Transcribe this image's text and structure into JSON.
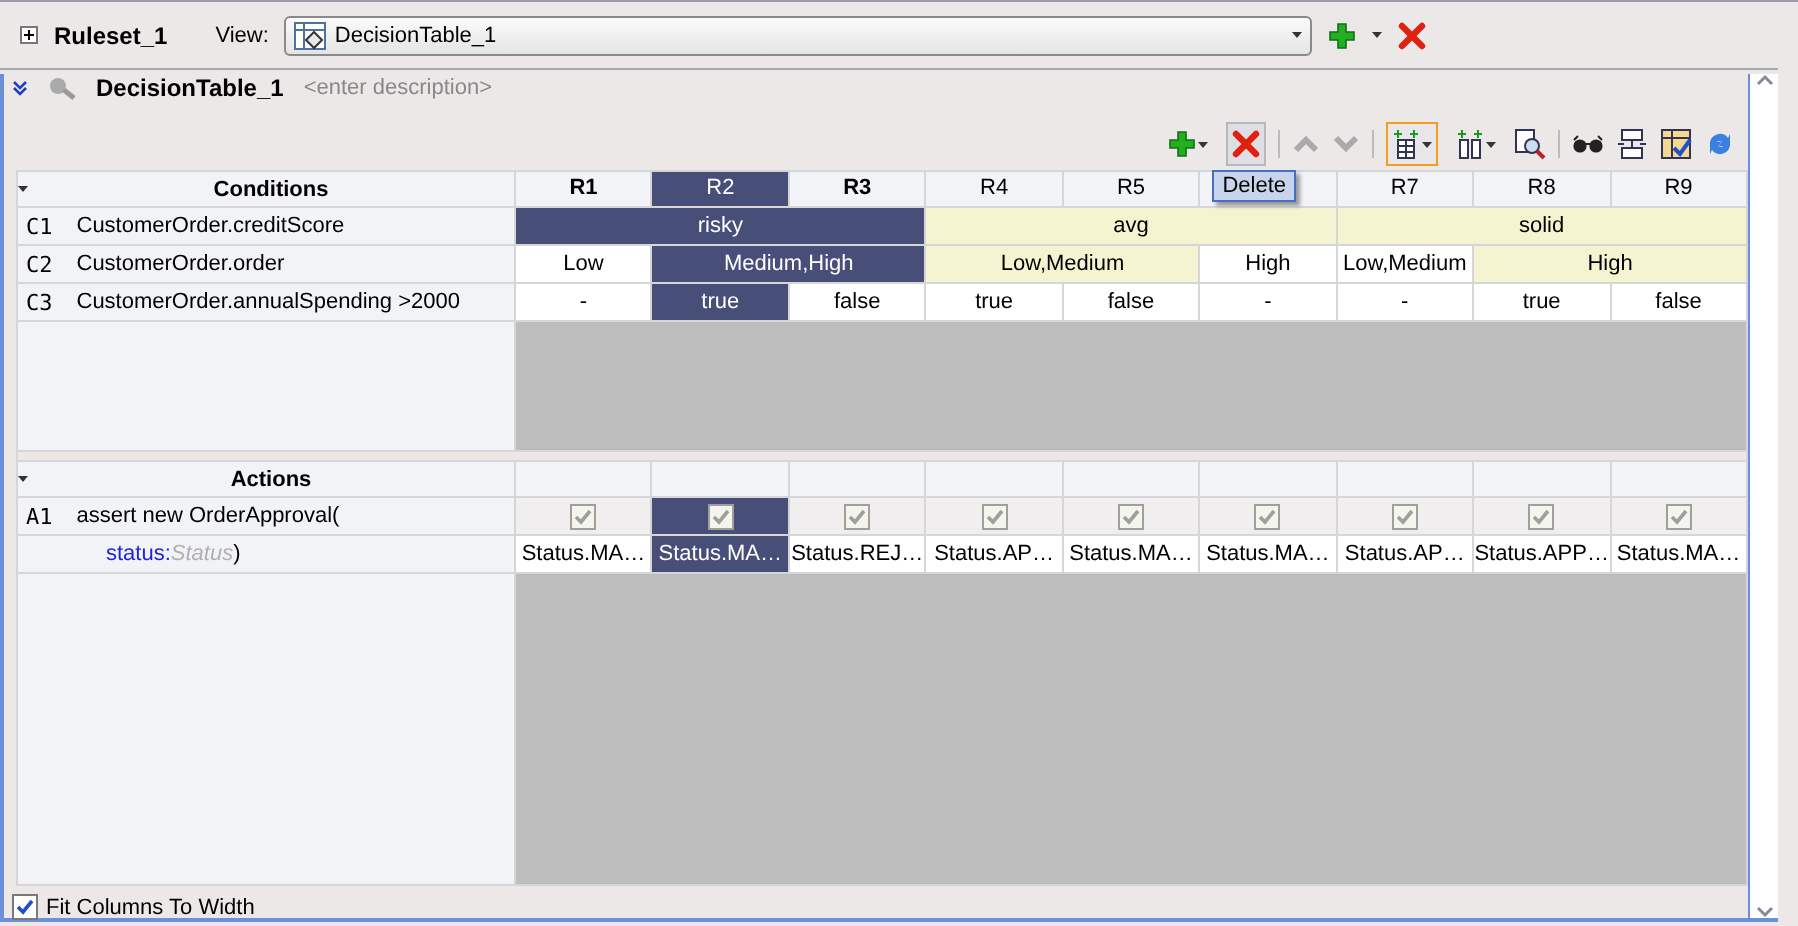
{
  "ruleset": {
    "title": "Ruleset_1"
  },
  "view": {
    "label": "View:",
    "value": "DecisionTable_1"
  },
  "decision_table": {
    "title": "DecisionTable_1",
    "placeholder": "<enter description>"
  },
  "tooltip": "Delete",
  "columns": [
    {
      "label": "R1",
      "selected": false
    },
    {
      "label": "R2",
      "selected": true
    },
    {
      "label": "R3",
      "selected": false
    },
    {
      "label": "R4",
      "selected": false
    },
    {
      "label": "R5",
      "selected": false
    },
    {
      "selected": false
    },
    {
      "label": "R7",
      "selected": false
    },
    {
      "label": "R8",
      "selected": false
    },
    {
      "label": "R9",
      "selected": false
    }
  ],
  "conditions": {
    "heading": "Conditions",
    "rows": [
      {
        "id": "C1",
        "name": "CustomerOrder.creditScore",
        "cells": [
          {
            "text": "risky"
          },
          {
            "merged": true
          },
          {
            "merged": true
          },
          {
            "text": "avg"
          },
          {
            "merged": true
          },
          {
            "merged": true
          },
          {
            "text": "solid"
          },
          {
            "merged": true
          },
          {
            "merged": true
          }
        ]
      },
      {
        "id": "C2",
        "name": "CustomerOrder.order",
        "cells": [
          {
            "text": "Low"
          },
          {
            "text": "Medium,High"
          },
          {
            "merged": true
          },
          {
            "text": "Low,Medium"
          },
          {
            "merged": true
          },
          {
            "text": "High"
          },
          {
            "text": "Low,Medium"
          },
          {
            "text": "High"
          },
          {
            "merged": true
          }
        ]
      },
      {
        "id": "C3",
        "name": "CustomerOrder.annualSpending >2000",
        "cells": [
          {
            "text": "-"
          },
          {
            "text": "true"
          },
          {
            "text": "false"
          },
          {
            "text": "true"
          },
          {
            "text": "false"
          },
          {
            "text": "-"
          },
          {
            "text": "-"
          },
          {
            "text": "true"
          },
          {
            "text": "false"
          }
        ]
      }
    ]
  },
  "actions": {
    "heading": "Actions",
    "rows": [
      {
        "id": "A1",
        "expression": "assert new OrderApproval(",
        "param_name": "status:",
        "param_type": "Status",
        "close": ")",
        "cells": [
          {
            "checked": true,
            "value": "Status.MA…"
          },
          {
            "checked": true,
            "value": "Status.MA…"
          },
          {
            "checked": true,
            "value": "Status.REJ…"
          },
          {
            "checked": true,
            "value": "Status.AP…"
          },
          {
            "checked": true,
            "value": "Status.MA…"
          },
          {
            "checked": true,
            "value": "Status.MA…"
          },
          {
            "checked": true,
            "value": "Status.AP…"
          },
          {
            "checked": true,
            "value": "Status.APP…"
          },
          {
            "checked": true,
            "value": "Status.MA…"
          }
        ]
      }
    ]
  },
  "footer": {
    "label": "Fit Columns To Width",
    "checked": true
  }
}
